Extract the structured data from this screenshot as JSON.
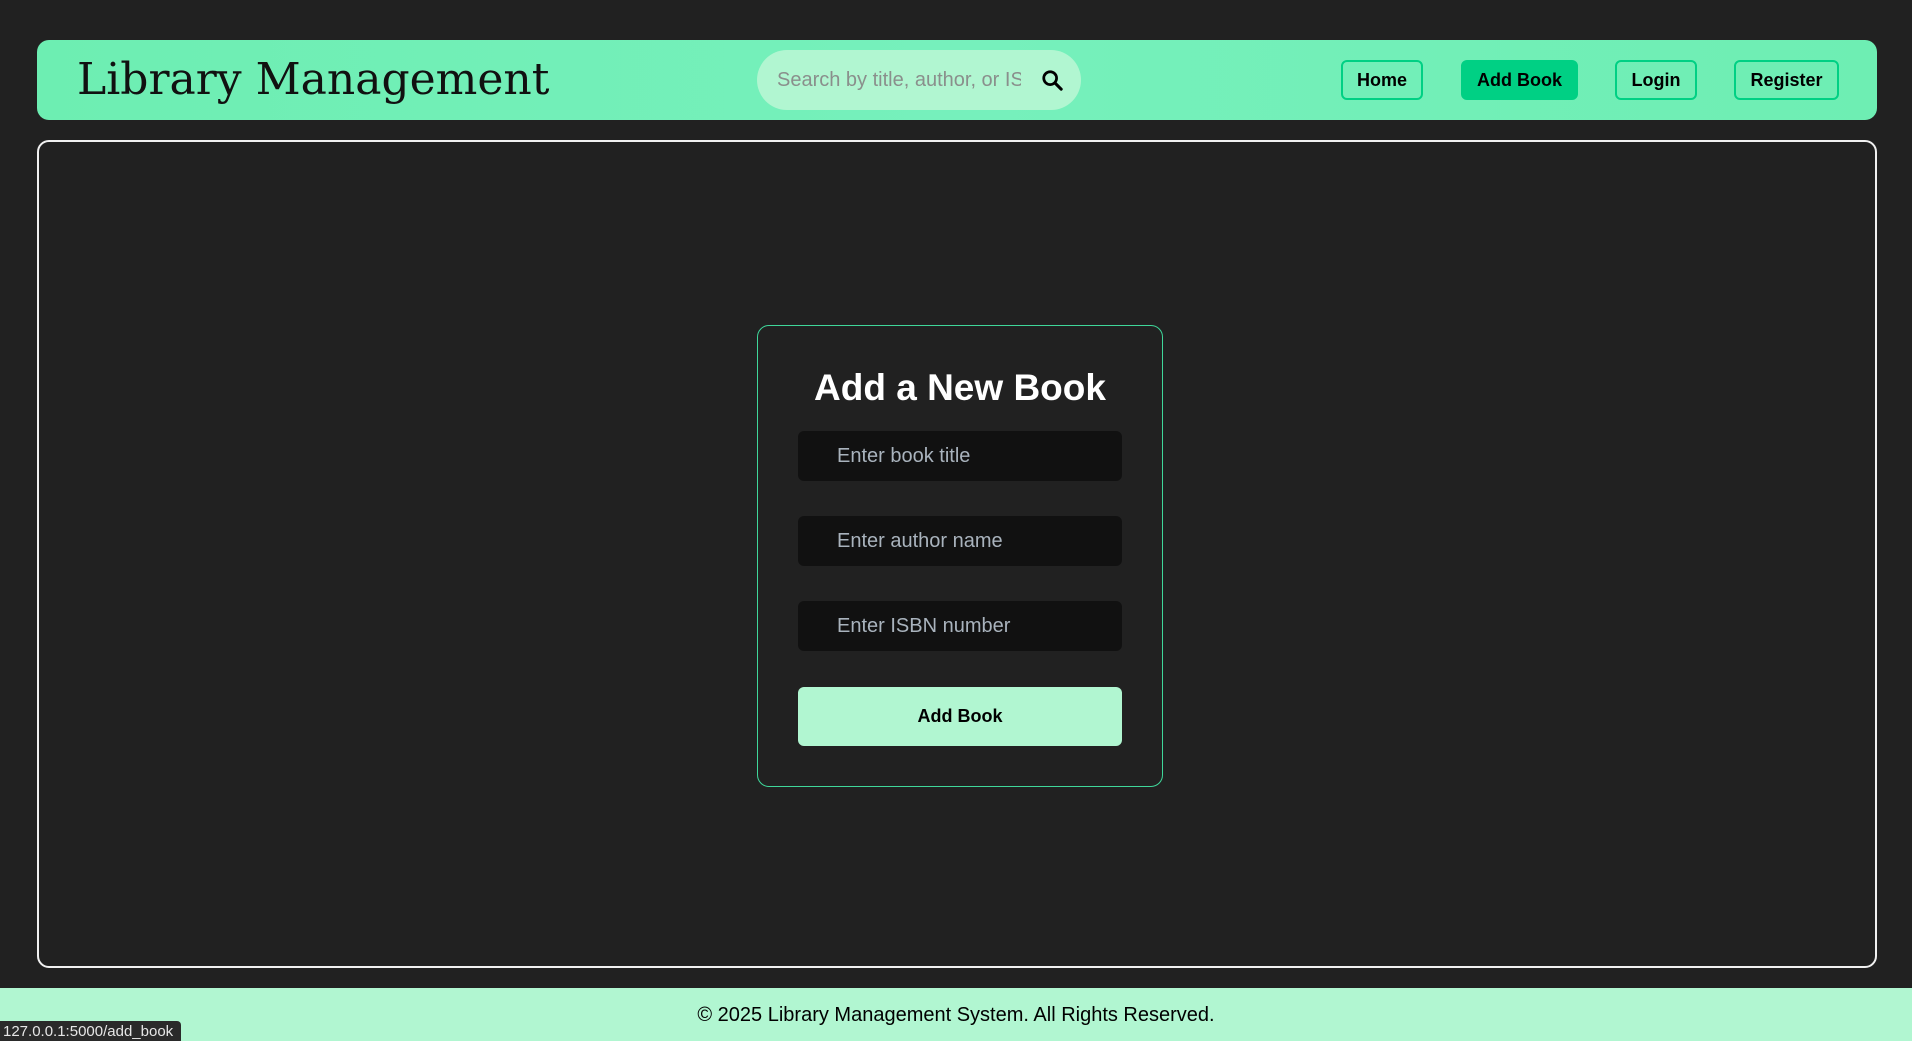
{
  "header": {
    "brand": "Library Management",
    "search": {
      "placeholder": "Search by title, author, or ISBN",
      "icon": "search-icon"
    },
    "nav": {
      "home": "Home",
      "add_book": "Add Book",
      "login": "Login",
      "register": "Register",
      "active": "add_book"
    }
  },
  "form": {
    "title": "Add a New Book",
    "title_placeholder": "Enter book title",
    "author_placeholder": "Enter author name",
    "isbn_placeholder": "Enter ISBN number",
    "submit_label": "Add Book"
  },
  "footer": {
    "text": "© 2025 Library Management System. All Rights Reserved."
  },
  "status_bar": {
    "url": "127.0.0.1:5000/add_book"
  },
  "colors": {
    "accent": "#00d084",
    "header_bg": "#6deeb2",
    "light_green": "#b1f6d1",
    "page_bg": "#212121",
    "input_bg": "#111111"
  }
}
